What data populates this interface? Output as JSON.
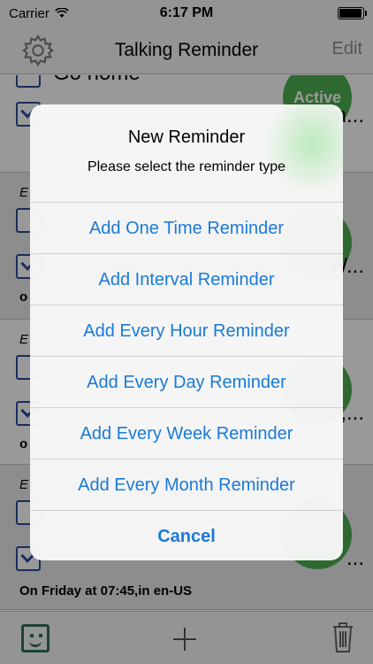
{
  "status": {
    "carrier": "Carrier",
    "time": "6:17 PM",
    "battery_fraction": 0.95
  },
  "nav": {
    "title": "Talking Reminder",
    "edit_label": "Edit",
    "settings_icon": "gear-icon"
  },
  "list": {
    "cells": [
      {
        "title": "Go home",
        "badge": "Active",
        "trail": "n..."
      },
      {
        "every": "E",
        "subtitle": "o",
        "trail": "W..."
      },
      {
        "every": "E",
        "subtitle": "o",
        "trail": ",..."
      },
      {
        "every": "E",
        "subtitle": "On Friday at 07:45,in en-US",
        "trail": "..."
      }
    ]
  },
  "alert": {
    "title": "New Reminder",
    "message": "Please select the reminder type",
    "actions": [
      {
        "label": "Add One Time Reminder"
      },
      {
        "label": "Add Interval Reminder"
      },
      {
        "label": "Add Every Hour Reminder"
      },
      {
        "label": "Add Every Day Reminder"
      },
      {
        "label": "Add Every Week Reminder"
      },
      {
        "label": "Add Every Month Reminder"
      }
    ],
    "cancel_label": "Cancel"
  },
  "toolbar": {
    "left_icon": "face-icon",
    "center_icon": "plus-icon",
    "right_icon": "trash-icon"
  },
  "colors": {
    "accent": "#1a7ad8",
    "active_badge": "#4caf50",
    "checkbox": "#2a4d9c"
  }
}
